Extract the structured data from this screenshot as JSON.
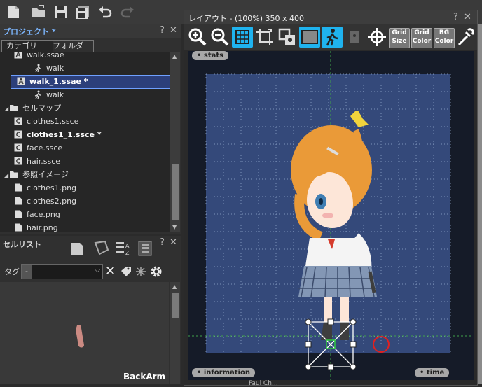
{
  "toolbar": {
    "icons": [
      "new-file-icon",
      "open-folder-icon",
      "save-icon",
      "save-all-icon",
      "undo-icon",
      "redo-icon"
    ]
  },
  "project_panel": {
    "title": "プロジェクト *",
    "help": "?",
    "close": "✕",
    "tabs": [
      "カテゴリ",
      "フォルダ"
    ],
    "items": [
      {
        "label": "walk.ssae",
        "type": "anim",
        "indent": 1,
        "bold": false
      },
      {
        "label": "walk",
        "type": "motion",
        "indent": 2,
        "bold": false
      },
      {
        "label": "walk_1.ssae *",
        "type": "anim",
        "indent": 1,
        "bold": true,
        "selected": true
      },
      {
        "label": "walk",
        "type": "motion",
        "indent": 2,
        "bold": false
      },
      {
        "label": "セルマップ",
        "type": "folder",
        "indent": 0,
        "bold": false
      },
      {
        "label": "clothes1.ssce",
        "type": "cell",
        "indent": 1,
        "bold": false
      },
      {
        "label": "clothes1_1.ssce *",
        "type": "cell",
        "indent": 1,
        "bold": true
      },
      {
        "label": "face.ssce",
        "type": "cell",
        "indent": 1,
        "bold": false
      },
      {
        "label": "hair.ssce",
        "type": "cell",
        "indent": 1,
        "bold": false
      },
      {
        "label": "参照イメージ",
        "type": "folder",
        "indent": 0,
        "bold": false
      },
      {
        "label": "clothes1.png",
        "type": "image",
        "indent": 1,
        "bold": false
      },
      {
        "label": "clothes2.png",
        "type": "image",
        "indent": 1,
        "bold": false
      },
      {
        "label": "face.png",
        "type": "image",
        "indent": 1,
        "bold": false
      },
      {
        "label": "hair.png",
        "type": "image",
        "indent": 1,
        "bold": false
      }
    ]
  },
  "cell_panel": {
    "title": "セルリスト",
    "help": "?",
    "close": "✕",
    "tag_label": "タグ",
    "tag_value": "-",
    "preview_label": "BackArm"
  },
  "layout_window": {
    "title": "レイアウト - (100%)  350 x 400",
    "help": "?",
    "close": "✕",
    "grid_size": [
      "Grid",
      "Size"
    ],
    "grid_color": [
      "Grid",
      "Color"
    ],
    "bg_color": [
      "BG",
      "Color"
    ],
    "stats_label": "stats",
    "information_label": "information",
    "time_label": "time",
    "bottom_text": "Faul Ch…"
  },
  "colors": {
    "canvas": "#34497a",
    "accent": "#1fb3ef",
    "selection": "#2c3f7a"
  }
}
